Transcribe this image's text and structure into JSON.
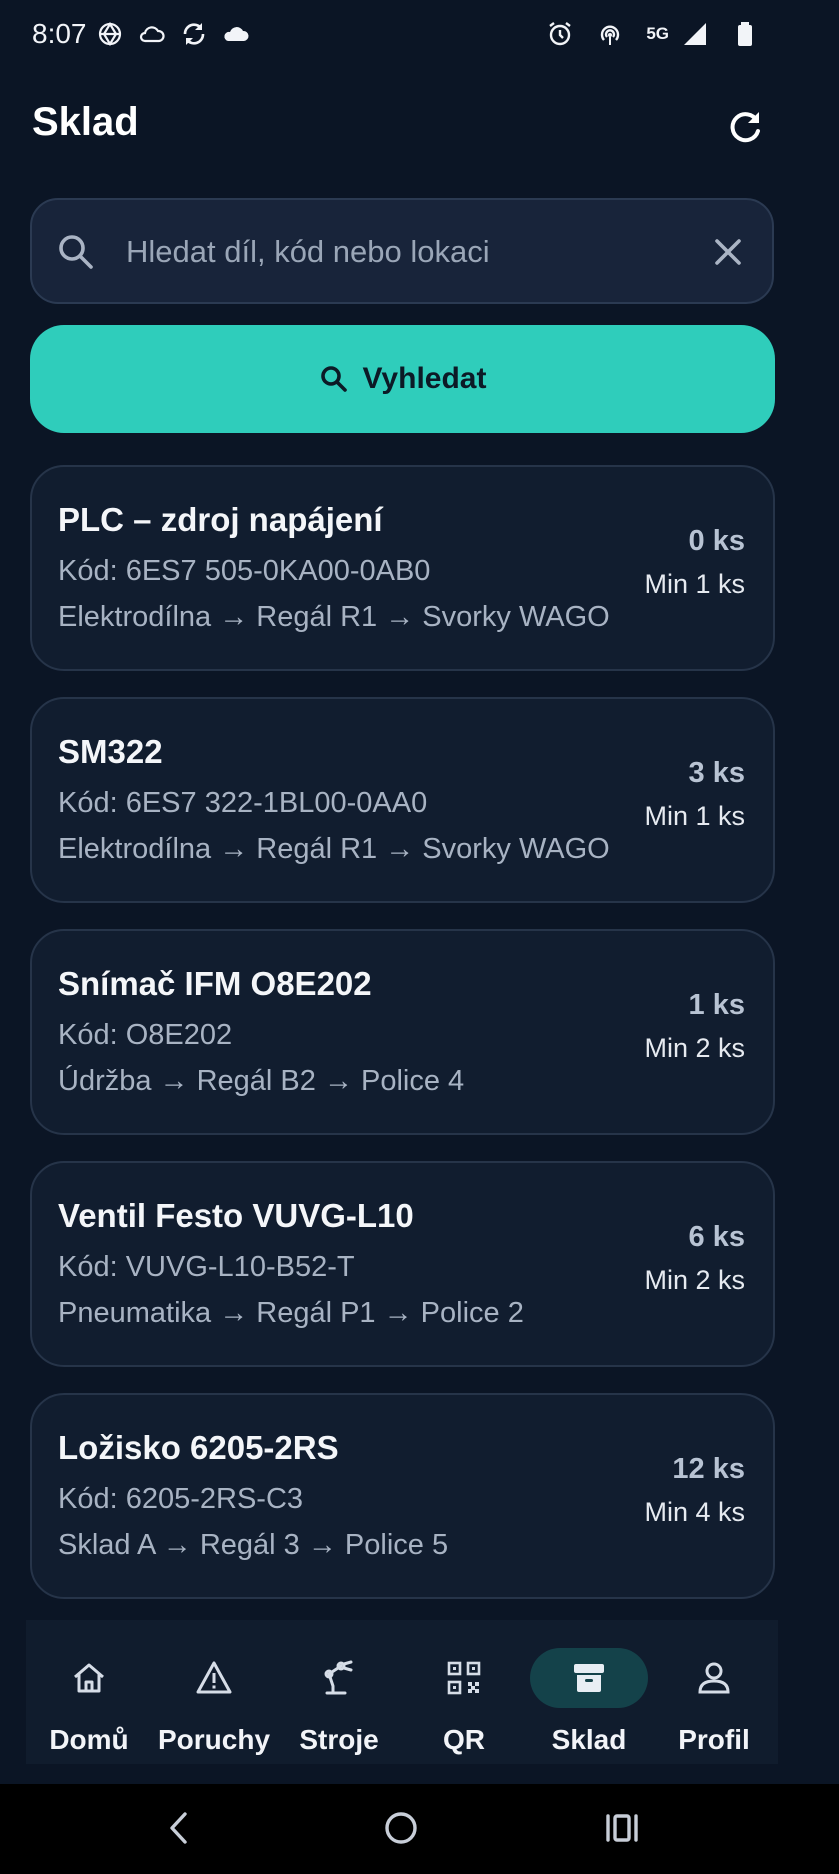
{
  "status_bar": {
    "time": "8:07",
    "network": "5G",
    "left_icons": [
      "openai-icon",
      "cloud-outline-icon",
      "sync-icon",
      "cloud-icon"
    ],
    "right_icons": [
      "alarm-icon",
      "hotspot-icon",
      "signal-icon",
      "battery-icon"
    ]
  },
  "header": {
    "title": "Sklad",
    "refresh_icon": "refresh-icon"
  },
  "search": {
    "placeholder": "Hledat díl, kód nebo lokaci",
    "value": "",
    "button_label": "Vyhledat"
  },
  "items": [
    {
      "name": "PLC – zdroj napájení",
      "code": "Kód: 6ES7 505-0KA00-0AB0",
      "location": "Elektrodílna → Regál R1 → Svorky WAGO",
      "quantity": "0 ks",
      "minimum": "Min 1 ks"
    },
    {
      "name": "SM322",
      "code": "Kód: 6ES7 322-1BL00-0AA0",
      "location": "Elektrodílna → Regál R1 → Svorky WAGO",
      "quantity": "3 ks",
      "minimum": "Min 1 ks"
    },
    {
      "name": "Snímač IFM O8E202",
      "code": "Kód: O8E202",
      "location": "Údržba → Regál B2 → Police 4",
      "quantity": "1 ks",
      "minimum": "Min 2 ks"
    },
    {
      "name": "Ventil Festo VUVG-L10",
      "code": "Kód: VUVG-L10-B52-T",
      "location": "Pneumatika → Regál P1 → Police 2",
      "quantity": "6 ks",
      "minimum": "Min 2 ks"
    },
    {
      "name": "Ložisko 6205-2RS",
      "code": "Kód: 6205-2RS-C3",
      "location": "Sklad A → Regál 3 → Police 5",
      "quantity": "12 ks",
      "minimum": "Min 4 ks"
    }
  ],
  "bottom_nav": {
    "active": "Sklad",
    "items": [
      {
        "label": "Domů",
        "icon": "home-icon"
      },
      {
        "label": "Poruchy",
        "icon": "warning-icon"
      },
      {
        "label": "Stroje",
        "icon": "robot-arm-icon"
      },
      {
        "label": "QR",
        "icon": "qr-code-icon"
      },
      {
        "label": "Sklad",
        "icon": "archive-icon"
      },
      {
        "label": "Profil",
        "icon": "person-icon"
      }
    ]
  },
  "colors": {
    "background": "#0b1525",
    "card": "#111d2f",
    "accent": "#2fcdbb",
    "active_pill": "#14424a"
  }
}
